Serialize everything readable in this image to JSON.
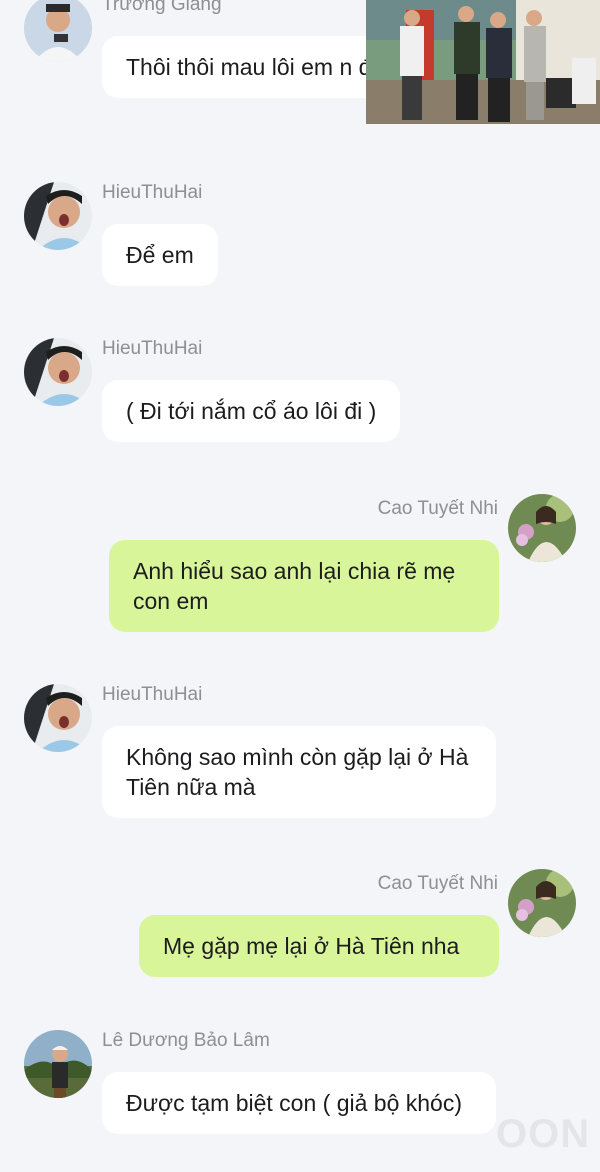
{
  "messages": [
    {
      "sender": "Trường Giang",
      "text": "Thôi thôi mau lôi em n đi",
      "direction": "incoming",
      "avatar": "avatar-truong-giang"
    },
    {
      "sender": "HieuThuHai",
      "text": "Để em",
      "direction": "incoming",
      "avatar": "avatar-hieuthuhai"
    },
    {
      "sender": "HieuThuHai",
      "text": "( Đi tới nắm cổ áo lôi đi )",
      "direction": "incoming",
      "avatar": "avatar-hieuthuhai"
    },
    {
      "sender": "Cao Tuyết Nhi",
      "text": "Anh hiểu sao anh lại chia rẽ mẹ con em",
      "direction": "outgoing",
      "avatar": "avatar-cao-tuyet-nhi"
    },
    {
      "sender": "HieuThuHai",
      "text": "Không sao mình còn gặp lại ở Hà Tiên nữa mà",
      "direction": "incoming",
      "avatar": "avatar-hieuthuhai"
    },
    {
      "sender": "Cao Tuyết Nhi",
      "text": "Mẹ gặp mẹ lại ở Hà Tiên nha",
      "direction": "outgoing",
      "avatar": "avatar-cao-tuyet-nhi"
    },
    {
      "sender": "Lê Dương Bảo Lâm",
      "text": "Được tạm biệt con ( giả bộ khóc)",
      "direction": "incoming",
      "avatar": "avatar-le-duong-bao-lam"
    }
  ],
  "sticker": {
    "icon": "photo-sticker-image"
  },
  "watermark": "OON",
  "colors": {
    "background": "#f4f5f8",
    "incoming_bubble": "#ffffff",
    "outgoing_bubble": "#d9f59a",
    "sender_name": "#8e8e93",
    "message_text": "#1c1c1e"
  }
}
